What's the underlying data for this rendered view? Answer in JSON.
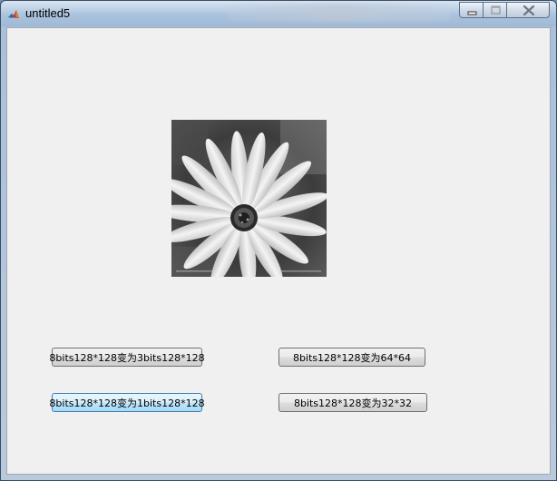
{
  "window": {
    "title": "untitled5"
  },
  "buttons": {
    "to_3bits": "8bits128*128变为3bits128*128",
    "to_64": "8bits128*128变为64*64",
    "to_1bits": "8bits128*128变为1bits128*128",
    "to_32": "8bits128*128变为32*32"
  },
  "icons": {
    "app": "matlab-icon",
    "minimize": "minimize-icon",
    "maximize": "maximize-icon",
    "close": "close-icon"
  },
  "image": {
    "subject": "grayscale daisy flower",
    "colormap": "gray"
  }
}
